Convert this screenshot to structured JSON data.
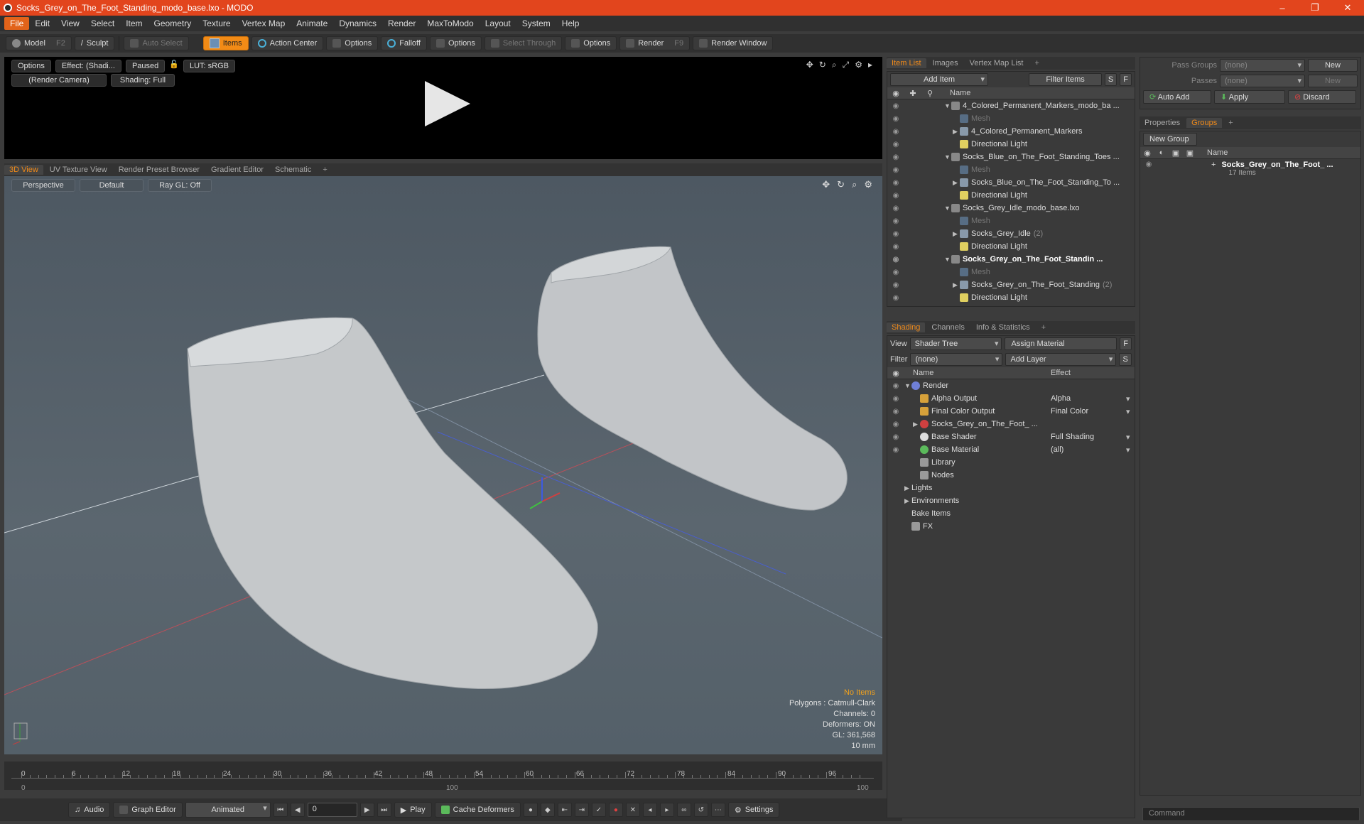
{
  "window": {
    "title": "Socks_Grey_on_The_Foot_Standing_modo_base.lxo - MODO",
    "minimize": "–",
    "maximize": "❐",
    "close": "✕"
  },
  "menu": [
    "File",
    "Edit",
    "View",
    "Select",
    "Item",
    "Geometry",
    "Texture",
    "Vertex Map",
    "Animate",
    "Dynamics",
    "Render",
    "MaxToModo",
    "Layout",
    "System",
    "Help"
  ],
  "toolbar": {
    "model": "Model",
    "model_key": "F2",
    "sculpt": "Sculpt",
    "auto_select": "Auto Select",
    "items": "Items",
    "action_center": "Action Center",
    "options1": "Options",
    "falloff": "Falloff",
    "options2": "Options",
    "select_through": "Select Through",
    "options3": "Options",
    "render": "Render",
    "render_key": "F9",
    "render_window": "Render Window"
  },
  "preview": {
    "options": "Options",
    "effect": "Effect: (Shadi...",
    "paused": "Paused",
    "lut": "LUT: sRGB",
    "camera": "(Render Camera)",
    "shading": "Shading: Full"
  },
  "view_tabs": [
    "3D View",
    "UV Texture View",
    "Render Preset Browser",
    "Gradient Editor",
    "Schematic",
    "+"
  ],
  "viewport": {
    "projection": "Perspective",
    "style": "Default",
    "raygl": "Ray GL: Off",
    "stats": {
      "items": "No Items",
      "polygons": "Polygons : Catmull-Clark",
      "channels": "Channels: 0",
      "deformers": "Deformers: ON",
      "gl": "GL: 361,568",
      "scale": "10 mm"
    }
  },
  "timeline": {
    "labels": [
      "0",
      "6",
      "12",
      "18",
      "24",
      "30",
      "36",
      "42",
      "48",
      "54",
      "60",
      "66",
      "72",
      "78",
      "84",
      "90",
      "96"
    ],
    "sub": [
      "0",
      "100",
      "100"
    ]
  },
  "transport": {
    "audio": "Audio",
    "graph_editor": "Graph Editor",
    "animated": "Animated",
    "frame": "0",
    "play": "Play",
    "cache": "Cache Deformers",
    "settings": "Settings"
  },
  "item_list": {
    "tabs": [
      "Item List",
      "Images",
      "Vertex Map List",
      "+"
    ],
    "add_item": "Add Item",
    "filter_items": "Filter Items",
    "s": "S",
    "f": "F",
    "name_col": "Name",
    "rows": [
      {
        "label": "4_Colored_Permanent_Markers_modo_ba ...",
        "type": "scene",
        "indent": 0,
        "arrow": "▼"
      },
      {
        "label": "Mesh",
        "type": "mesh",
        "indent": 1,
        "arrow": ""
      },
      {
        "label": "4_Colored_Permanent_Markers",
        "type": "group",
        "indent": 1,
        "arrow": "▶"
      },
      {
        "label": "Directional Light",
        "type": "light",
        "indent": 1,
        "arrow": ""
      },
      {
        "label": "Socks_Blue_on_The_Foot_Standing_Toes ...",
        "type": "scene",
        "indent": 0,
        "arrow": "▼"
      },
      {
        "label": "Mesh",
        "type": "mesh",
        "indent": 1,
        "arrow": ""
      },
      {
        "label": "Socks_Blue_on_The_Foot_Standing_To ...",
        "type": "group",
        "indent": 1,
        "arrow": "▶"
      },
      {
        "label": "Directional Light",
        "type": "light",
        "indent": 1,
        "arrow": ""
      },
      {
        "label": "Socks_Grey_Idle_modo_base.lxo",
        "type": "scene",
        "indent": 0,
        "arrow": "▼"
      },
      {
        "label": "Mesh",
        "type": "mesh",
        "indent": 1,
        "arrow": ""
      },
      {
        "label": "Socks_Grey_Idle",
        "count": "(2)",
        "type": "group",
        "indent": 1,
        "arrow": "▶"
      },
      {
        "label": "Directional Light",
        "type": "light",
        "indent": 1,
        "arrow": ""
      },
      {
        "label": "Socks_Grey_on_The_Foot_Standin ...",
        "type": "scene",
        "indent": 0,
        "arrow": "▼",
        "bold": true
      },
      {
        "label": "Mesh",
        "type": "mesh",
        "indent": 1,
        "arrow": ""
      },
      {
        "label": "Socks_Grey_on_The_Foot_Standing",
        "count": "(2)",
        "type": "group",
        "indent": 1,
        "arrow": "▶"
      },
      {
        "label": "Directional Light",
        "type": "light",
        "indent": 1,
        "arrow": ""
      }
    ]
  },
  "shading": {
    "tabs": [
      "Shading",
      "Channels",
      "Info & Statistics",
      "+"
    ],
    "view_label": "View",
    "view_value": "Shader Tree",
    "assign_material": "Assign Material",
    "f": "F",
    "filter_label": "Filter",
    "filter_value": "(none)",
    "add_layer": "Add Layer",
    "s": "S",
    "name_col": "Name",
    "effect_col": "Effect",
    "rows": [
      {
        "label": "Render",
        "type": "render",
        "indent": 0,
        "arrow": "▼",
        "effect": ""
      },
      {
        "label": "Alpha Output",
        "type": "alpha",
        "indent": 1,
        "arrow": "",
        "effect": "Alpha"
      },
      {
        "label": "Final Color Output",
        "type": "alpha",
        "indent": 1,
        "arrow": "",
        "effect": "Final Color"
      },
      {
        "label": "Socks_Grey_on_The_Foot_ ...",
        "type": "matred",
        "indent": 1,
        "arrow": "▶",
        "effect": ""
      },
      {
        "label": "Base Shader",
        "type": "shader",
        "indent": 1,
        "arrow": "",
        "effect": "Full Shading"
      },
      {
        "label": "Base Material",
        "type": "material",
        "indent": 1,
        "arrow": "",
        "effect": "(all)"
      },
      {
        "label": "Library",
        "type": "folder",
        "indent": 1,
        "arrow": "",
        "effect": ""
      },
      {
        "label": "Nodes",
        "type": "folder",
        "indent": 1,
        "arrow": "",
        "effect": ""
      },
      {
        "label": "Lights",
        "type": "none",
        "indent": 0,
        "arrow": "▶",
        "effect": ""
      },
      {
        "label": "Environments",
        "type": "none",
        "indent": 0,
        "arrow": "▶",
        "effect": ""
      },
      {
        "label": "Bake Items",
        "type": "none",
        "indent": 0,
        "arrow": "",
        "effect": ""
      },
      {
        "label": "FX",
        "type": "folder",
        "indent": 0,
        "arrow": "",
        "effect": ""
      }
    ]
  },
  "right": {
    "pass_groups": "Pass Groups",
    "pass_groups_value": "(none)",
    "new": "New",
    "passes": "Passes",
    "passes_value": "(none)",
    "new2": "New",
    "auto_add": "Auto Add",
    "apply": "Apply",
    "discard": "Discard",
    "tabs": [
      "Properties",
      "Groups",
      "+"
    ],
    "new_group": "New Group",
    "name_col": "Name",
    "group_name": "Socks_Grey_on_The_Foot_ ...",
    "group_items": "17 Items",
    "command": "Command"
  }
}
